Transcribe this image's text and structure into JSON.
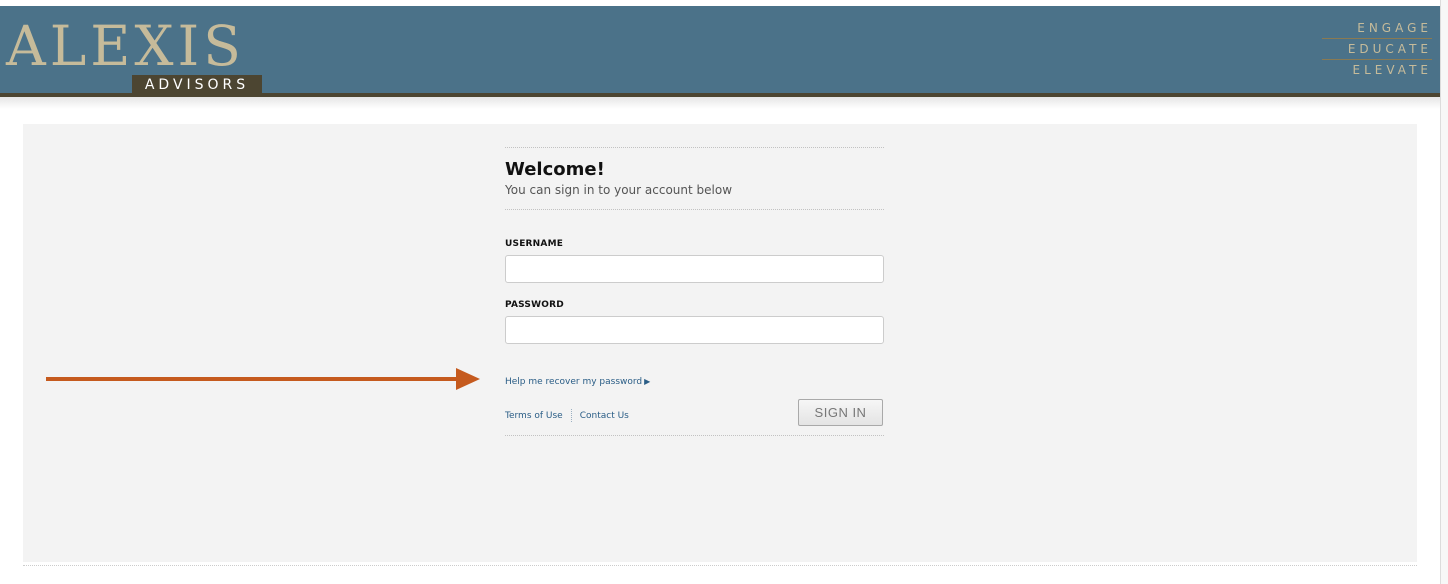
{
  "header": {
    "logo_word": "ALEXIS",
    "logo_sub": "ADVISORS",
    "taglines": [
      "ENGAGE",
      "EDUCATE",
      "ELEVATE"
    ]
  },
  "form": {
    "welcome": "Welcome!",
    "subtitle": "You can sign in to your account below",
    "username_label": "USERNAME",
    "username_value": "",
    "password_label": "PASSWORD",
    "password_value": "",
    "recover_link": "Help me recover my password",
    "recover_icon": "play-triangle",
    "terms_link": "Terms of Use",
    "contact_link": "Contact Us",
    "signin_button": "SIGN IN"
  },
  "colors": {
    "header_bg": "#4b7289",
    "accent_brown": "#4c4531",
    "logo_gold": "#c6bb9a",
    "link_blue": "#2a5d86",
    "annotation_arrow": "#c55a1e"
  }
}
